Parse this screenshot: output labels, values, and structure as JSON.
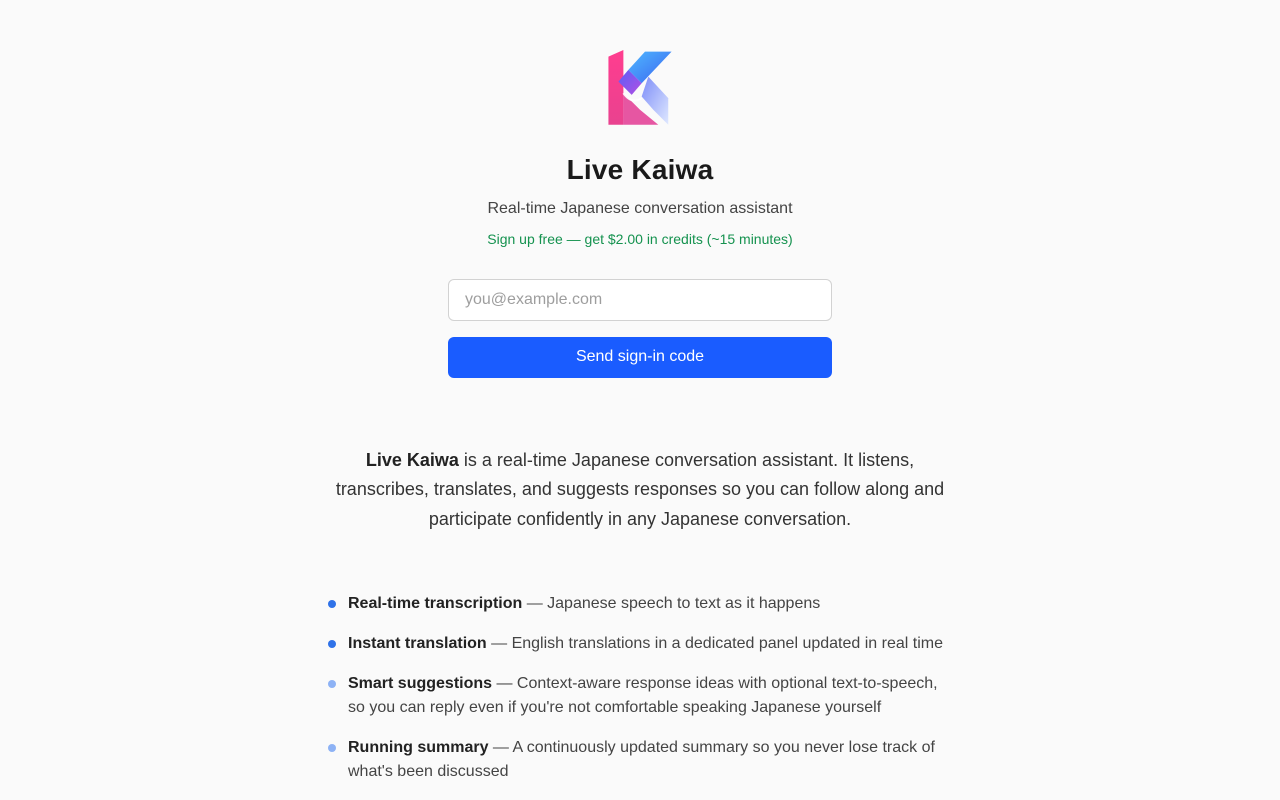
{
  "app": {
    "name": "Live Kaiwa",
    "tagline": "Real-time Japanese conversation assistant",
    "promo": "Sign up free — get $2.00 in credits (~15 minutes)"
  },
  "signin": {
    "email_placeholder": "you@example.com",
    "email_value": "",
    "submit_label": "Send sign-in code"
  },
  "about": {
    "brand": "Live Kaiwa",
    "text": " is a real-time Japanese conversation assistant. It listens, transcribes, translates, and suggests responses so you can follow along and participate confidently in any Japanese conversation."
  },
  "features": [
    {
      "title": "Real-time transcription",
      "description": " — Japanese speech to text as it happens"
    },
    {
      "title": "Instant translation",
      "description": " — English translations in a dedicated panel updated in real time"
    },
    {
      "title": "Smart suggestions",
      "description": " — Context-aware response ideas with optional text-to-speech, so you can reply even if you're not comfortable speaking Japanese yourself"
    },
    {
      "title": "Running summary",
      "description": " — A continuously updated summary so you never lose track of what's been discussed"
    }
  ],
  "colors": {
    "accent": "#1a5cff",
    "promo": "#15924f",
    "bullet": "#2f72e8",
    "bullet_light": "#8db2f5"
  },
  "icons": {
    "logo": "live-kaiwa-logo-icon",
    "bullet": "bullet-dot-icon"
  }
}
